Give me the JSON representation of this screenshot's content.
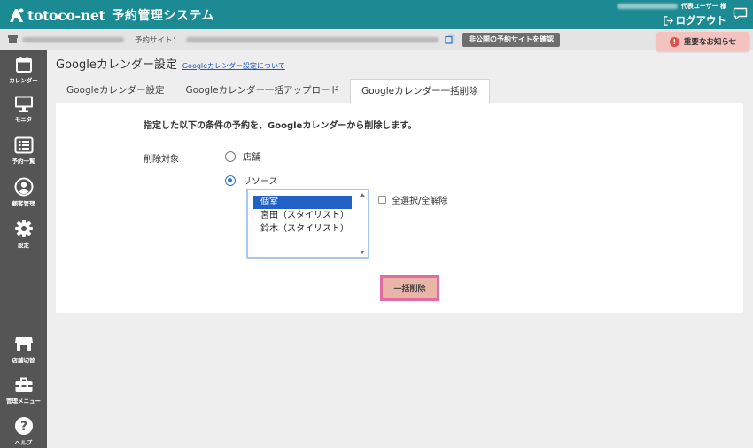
{
  "header": {
    "logo_text": "totoco-net",
    "app_title": "予約管理システム",
    "user_role": "代表ユーザー 様",
    "logout_label": "ログアウト"
  },
  "subbar": {
    "site_label": "予約サイト：",
    "private_site_button": "非公開の予約サイトを確認"
  },
  "notice": {
    "label": "重要なお知らせ",
    "badge": "!"
  },
  "sidebar": {
    "items": [
      {
        "label": "カレンダー",
        "icon": "calendar-icon"
      },
      {
        "label": "モニタ",
        "icon": "monitor-icon"
      },
      {
        "label": "予約一覧",
        "icon": "list-icon"
      },
      {
        "label": "顧客管理",
        "icon": "user-icon"
      },
      {
        "label": "設定",
        "icon": "gear-icon"
      }
    ],
    "bottom_items": [
      {
        "label": "店舗切替",
        "icon": "store-icon"
      },
      {
        "label": "管理メニュー",
        "icon": "toolbox-icon"
      },
      {
        "label": "ヘルプ",
        "icon": "help-icon"
      }
    ]
  },
  "page": {
    "title": "Googleカレンダー設定",
    "help_link": "Googleカレンダー設定について"
  },
  "tabs": [
    {
      "label": "Googleカレンダー設定",
      "active": false
    },
    {
      "label": "Googleカレンダー一括アップロード",
      "active": false
    },
    {
      "label": "Googleカレンダー一括削除",
      "active": true
    }
  ],
  "form": {
    "intro": "指定した以下の条件の予約を、Googleカレンダーから削除します。",
    "target_label": "削除対象",
    "options": [
      {
        "label": "店舗",
        "checked": false
      },
      {
        "label": "リソース",
        "checked": true
      }
    ],
    "resources": [
      {
        "label": "個室",
        "selected": true
      },
      {
        "label": "宮田（スタイリスト）",
        "selected": false
      },
      {
        "label": "鈴木（スタイリスト）",
        "selected": false
      }
    ],
    "select_all_label": "全選択/全解除",
    "delete_button": "一括削除"
  },
  "colors": {
    "header": "#1b8a93",
    "sidebar": "#555555",
    "notice": "#f4c2bf",
    "delete_button": "#eab5a9",
    "delete_border": "#e26c9f",
    "selected_option": "#2160c4"
  }
}
